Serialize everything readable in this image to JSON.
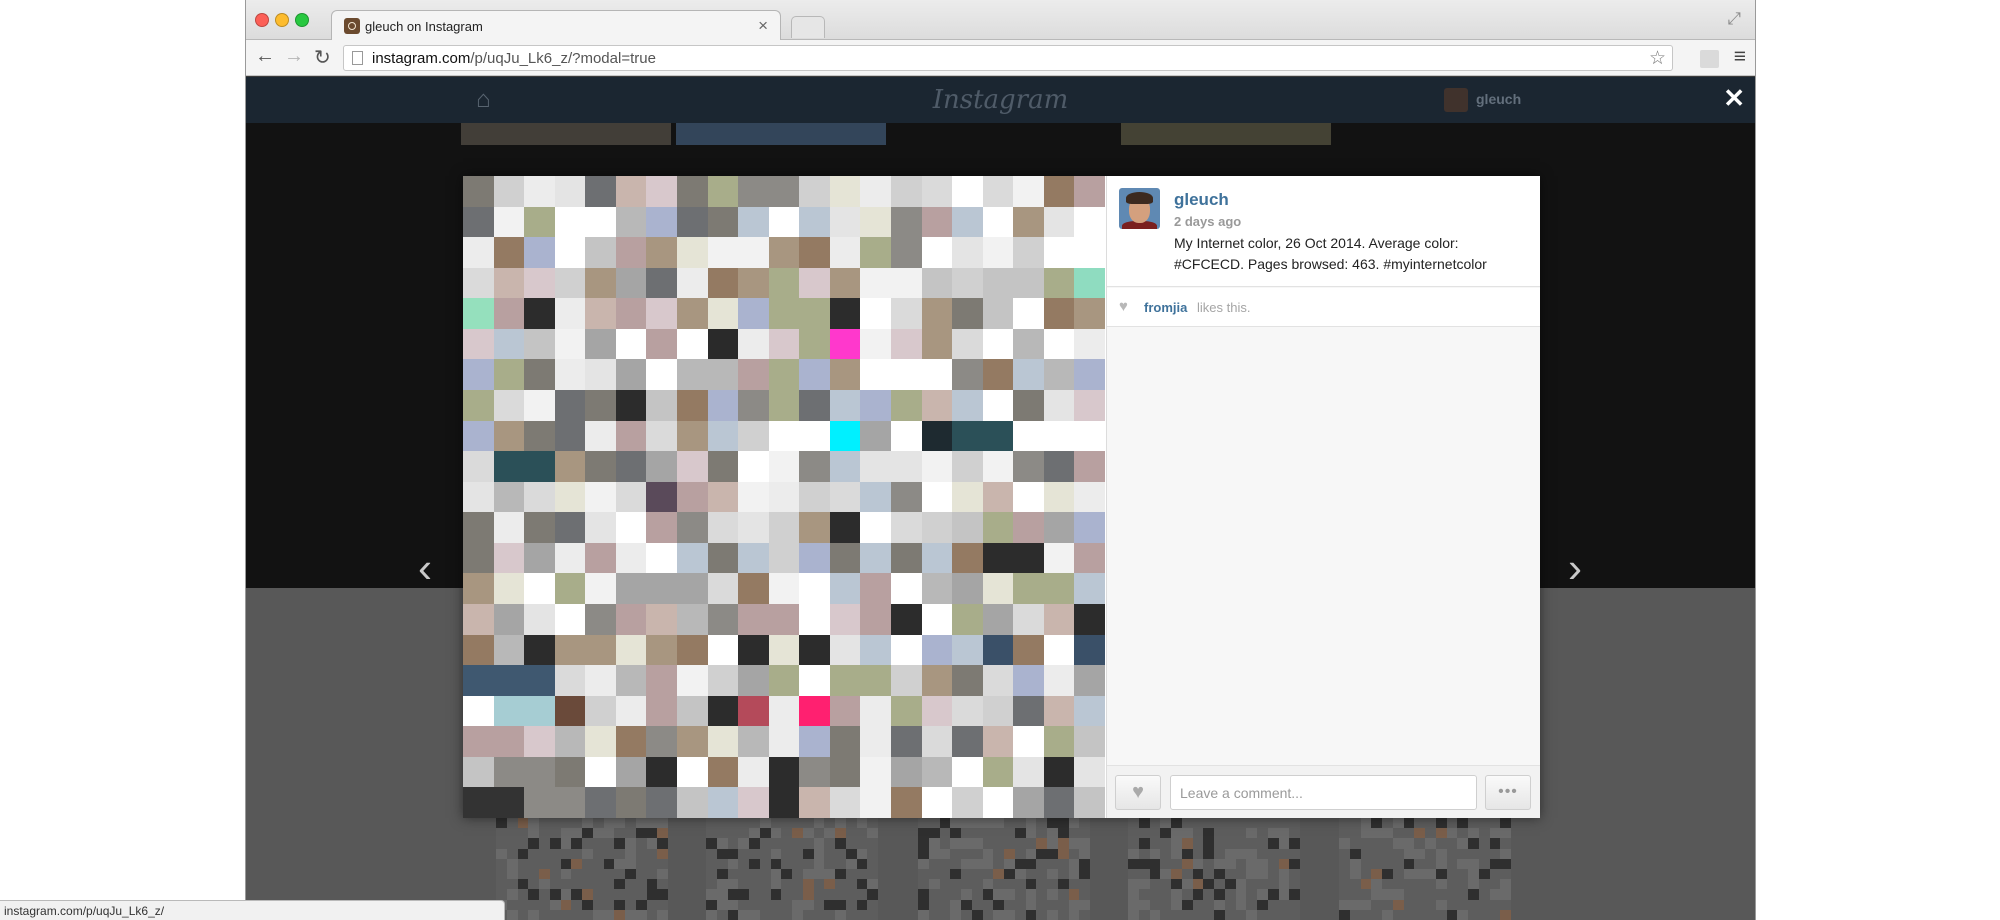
{
  "browser": {
    "tab_title": "gleuch on Instagram",
    "url_domain": "instagram.com",
    "url_path": "/p/uqJu_Lk6_z/?modal=true",
    "status_url": "instagram.com/p/uqJu_Lk6_z/"
  },
  "header": {
    "logo": "Instagram",
    "username": "gleuch"
  },
  "post": {
    "username": "gleuch",
    "time": "2 days ago",
    "caption": "My Internet color, 26 Oct 2014. Average color: #CFCECD. Pages browsed: 463. #myinternetcolor",
    "liker": "fromjia",
    "likes_suffix": "likes this.",
    "comment_placeholder": "Leave a comment...",
    "average_color": "#CFCECD"
  },
  "colors": {
    "accent": "#3f729b",
    "nav_bar": "#1b2631"
  },
  "icons": [
    "home-icon",
    "close-icon",
    "heart-icon",
    "more-icon",
    "star-icon",
    "menu-icon",
    "back-arrow-icon",
    "forward-arrow-icon",
    "reload-icon",
    "prev-arrow-icon",
    "next-arrow-icon"
  ]
}
